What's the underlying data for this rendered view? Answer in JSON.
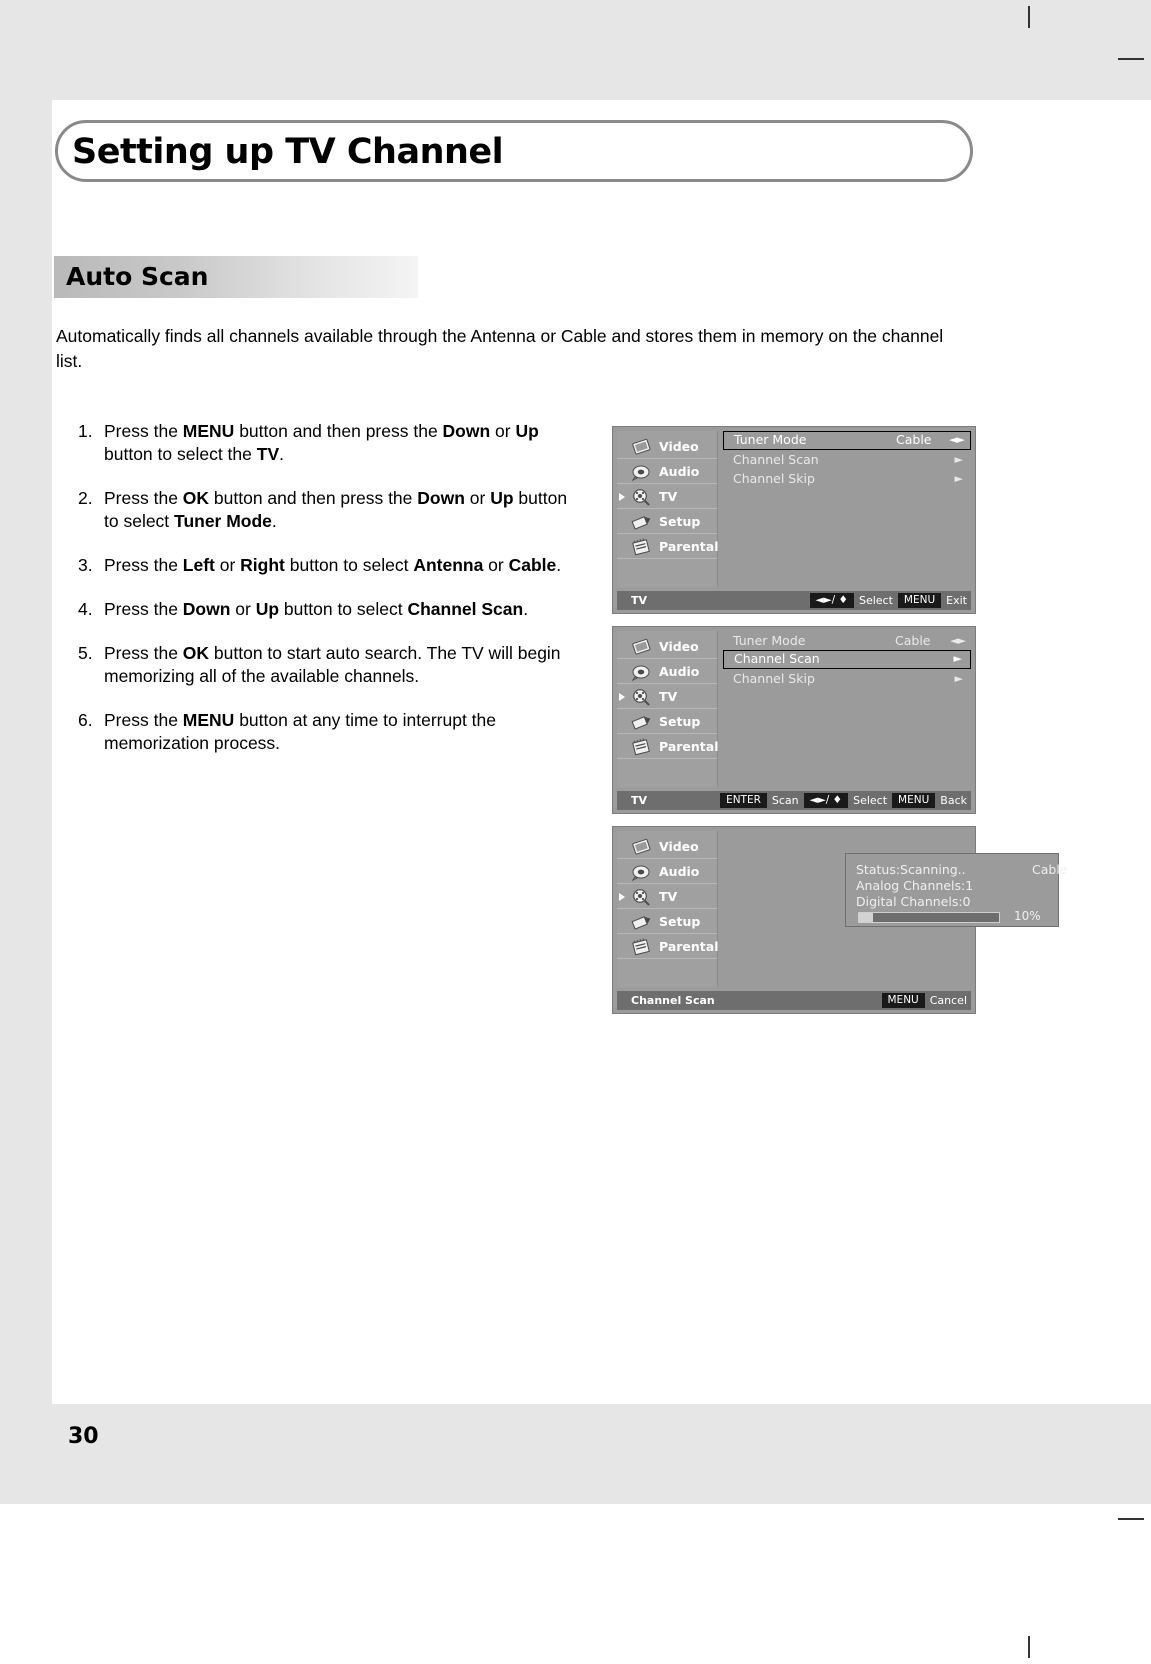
{
  "document": {
    "title": "Setting up TV Channel",
    "section_heading": "Auto Scan",
    "intro": "Automatically finds all channels available through the Antenna or Cable and stores them in memory on the channel list.",
    "page_number": "30"
  },
  "steps": [
    {
      "num": "1.",
      "parts": [
        {
          "t": "Press the ",
          "b": false
        },
        {
          "t": "MENU",
          "b": true
        },
        {
          "t": " button and then press the ",
          "b": false
        },
        {
          "t": "Down",
          "b": true
        },
        {
          "t": " or ",
          "b": false
        },
        {
          "t": "Up",
          "b": true
        },
        {
          "t": " button to select the ",
          "b": false
        },
        {
          "t": "TV",
          "b": true
        },
        {
          "t": ".",
          "b": false
        }
      ]
    },
    {
      "num": "2.",
      "parts": [
        {
          "t": "Press the ",
          "b": false
        },
        {
          "t": "OK",
          "b": true
        },
        {
          "t": " button and then press the ",
          "b": false
        },
        {
          "t": "Down",
          "b": true
        },
        {
          "t": " or ",
          "b": false
        },
        {
          "t": "Up",
          "b": true
        },
        {
          "t": " button to select ",
          "b": false
        },
        {
          "t": "Tuner Mode",
          "b": true
        },
        {
          "t": ".",
          "b": false
        }
      ]
    },
    {
      "num": "3.",
      "parts": [
        {
          "t": "Press the ",
          "b": false
        },
        {
          "t": "Left",
          "b": true
        },
        {
          "t": " or ",
          "b": false
        },
        {
          "t": "Right",
          "b": true
        },
        {
          "t": " button to select ",
          "b": false
        },
        {
          "t": "Antenna",
          "b": true
        },
        {
          "t": " or ",
          "b": false
        },
        {
          "t": "Cable",
          "b": true
        },
        {
          "t": ".",
          "b": false
        }
      ]
    },
    {
      "num": "4.",
      "parts": [
        {
          "t": "Press the ",
          "b": false
        },
        {
          "t": "Down",
          "b": true
        },
        {
          "t": " or ",
          "b": false
        },
        {
          "t": "Up",
          "b": true
        },
        {
          "t": " button to select ",
          "b": false
        },
        {
          "t": "Channel Scan",
          "b": true
        },
        {
          "t": ".",
          "b": false
        }
      ]
    },
    {
      "num": "5.",
      "parts": [
        {
          "t": "Press the ",
          "b": false
        },
        {
          "t": "OK",
          "b": true
        },
        {
          "t": " button to start auto search. The TV will begin memorizing all of the available channels.",
          "b": false
        }
      ]
    },
    {
      "num": "6.",
      "parts": [
        {
          "t": "Press the ",
          "b": false
        },
        {
          "t": "MENU",
          "b": true
        },
        {
          "t": " button at any time to interrupt the memorization process.",
          "b": false
        }
      ]
    }
  ],
  "osd_sidebar": [
    {
      "label": "Video",
      "icon": "video-icon",
      "selected": false
    },
    {
      "label": "Audio",
      "icon": "audio-icon",
      "selected": false
    },
    {
      "label": "TV",
      "icon": "tv-icon",
      "selected": true
    },
    {
      "label": "Setup",
      "icon": "setup-icon",
      "selected": false
    },
    {
      "label": "Parental",
      "icon": "parental-icon",
      "selected": false
    }
  ],
  "panels": [
    {
      "name": "tuner-mode-panel",
      "rows": [
        {
          "label": "Tuner Mode",
          "value": "Cable",
          "arrow": "◄►",
          "selected": true
        },
        {
          "label": "Channel Scan",
          "value": "",
          "arrow": "►",
          "selected": false
        },
        {
          "label": "Channel Skip",
          "value": "",
          "arrow": "►",
          "selected": false
        }
      ],
      "bottom": {
        "context": "TV",
        "items": [
          {
            "text": "◄►/ ♦",
            "chip": true
          },
          {
            "text": "Select",
            "chip": false
          },
          {
            "text": "MENU",
            "chip": true
          },
          {
            "text": "Exit",
            "chip": false
          }
        ]
      }
    },
    {
      "name": "channel-scan-panel",
      "rows": [
        {
          "label": "Tuner Mode",
          "value": "Cable",
          "arrow": "◄►",
          "selected": false
        },
        {
          "label": "Channel Scan",
          "value": "",
          "arrow": "►",
          "selected": true
        },
        {
          "label": "Channel Skip",
          "value": "",
          "arrow": "►",
          "selected": false
        }
      ],
      "bottom": {
        "context": "TV",
        "items": [
          {
            "text": "ENTER",
            "chip": true
          },
          {
            "text": "Scan",
            "chip": false
          },
          {
            "text": "◄►/ ♦",
            "chip": true
          },
          {
            "text": "Select",
            "chip": false
          },
          {
            "text": "MENU",
            "chip": true
          },
          {
            "text": "Back",
            "chip": false
          }
        ]
      }
    },
    {
      "name": "scanning-progress-panel",
      "scan": {
        "status": "Status:Scanning..",
        "source": "Cable",
        "analog": "Analog Channels:1",
        "digital": "Digital Channels:0",
        "percent_label": "10%",
        "percent_value": 10
      },
      "bottom": {
        "context": "Channel Scan",
        "items": [
          {
            "text": "MENU",
            "chip": true
          },
          {
            "text": "Cancel",
            "chip": false
          }
        ]
      }
    }
  ]
}
